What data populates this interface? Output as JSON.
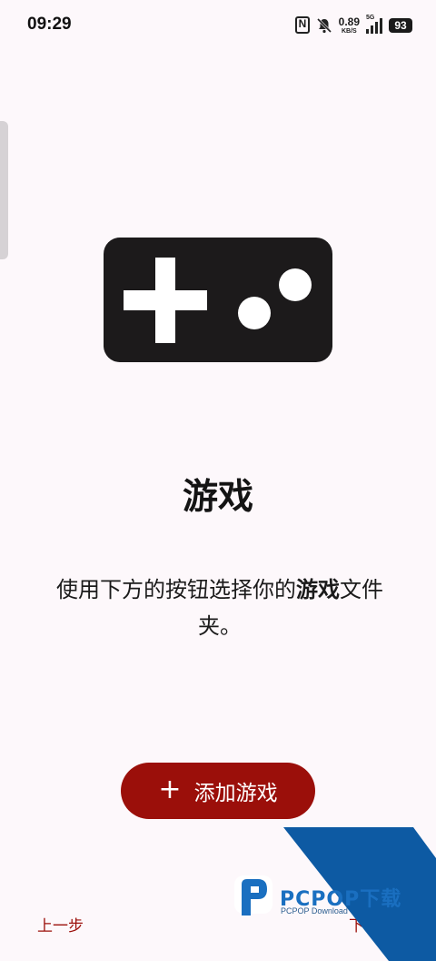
{
  "status_bar": {
    "time": "09:29",
    "net_speed_value": "0.89",
    "net_speed_unit": "KB/S",
    "network_type": "5G",
    "battery": "93"
  },
  "main": {
    "title": "游戏",
    "description_prefix": "使用下方的按钮选择你的",
    "description_bold": "游戏",
    "description_suffix": "文件夹。",
    "add_button_icon": "+",
    "add_button_label": "添加游戏"
  },
  "navigation": {
    "previous_label": "上一步",
    "next_label": "下"
  },
  "watermark": {
    "brand": "PCPOP下载",
    "subtitle": "PCPOP Download"
  },
  "colors": {
    "accent": "#9b0f0a",
    "background": "#fdf8fb",
    "illustration": "#1c1a1b",
    "watermark_blue": "#0d5aa3"
  },
  "icons": {
    "illustration": "gamepad-icon",
    "add": "plus-icon"
  }
}
